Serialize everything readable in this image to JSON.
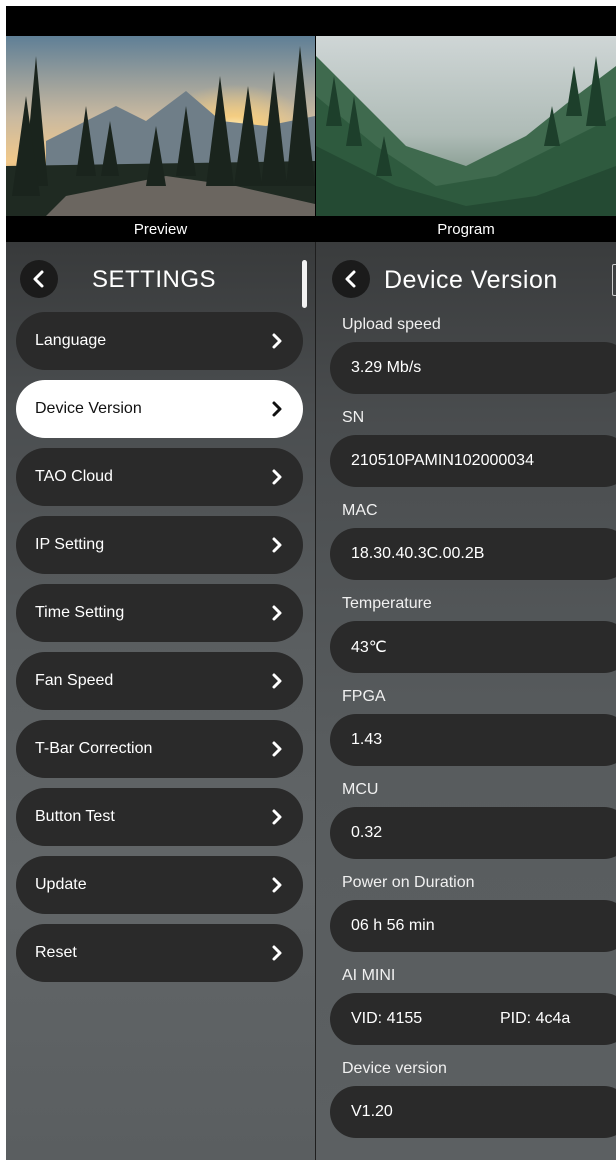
{
  "monitors": {
    "preview_label": "Preview",
    "program_label": "Program"
  },
  "settings": {
    "title": "SETTINGS",
    "items": [
      {
        "label": "Language"
      },
      {
        "label": "Device Version"
      },
      {
        "label": "TAO Cloud"
      },
      {
        "label": "IP Setting"
      },
      {
        "label": "Time Setting"
      },
      {
        "label": "Fan Speed"
      },
      {
        "label": "T-Bar Correction"
      },
      {
        "label": "Button Test"
      },
      {
        "label": "Update"
      },
      {
        "label": "Reset"
      }
    ],
    "active_item": "Device Version"
  },
  "device_version": {
    "title": "Device Version",
    "fields": [
      {
        "label": "Upload speed",
        "value": "3.29 Mb/s"
      },
      {
        "label": "SN",
        "value": "210510PAMIN102000034"
      },
      {
        "label": "MAC",
        "value": "18.30.40.3C.00.2B"
      },
      {
        "label": "Temperature",
        "value": "43℃"
      },
      {
        "label": "FPGA",
        "value": "1.43"
      },
      {
        "label": "MCU",
        "value": "0.32"
      },
      {
        "label": "Power on Duration",
        "value": "06 h 56 min"
      },
      {
        "label": "AI MINI",
        "vid": "VID: 4155",
        "pid": "PID: 4c4a"
      },
      {
        "label": "Device version",
        "value": "V1.20"
      }
    ]
  },
  "colors": {
    "pill": "#2a2a2a",
    "active_pill": "#ffffff",
    "accent_text": "#ffffff"
  },
  "icons": {
    "back": "chevron-left-icon",
    "item": "chevron-right-icon"
  }
}
